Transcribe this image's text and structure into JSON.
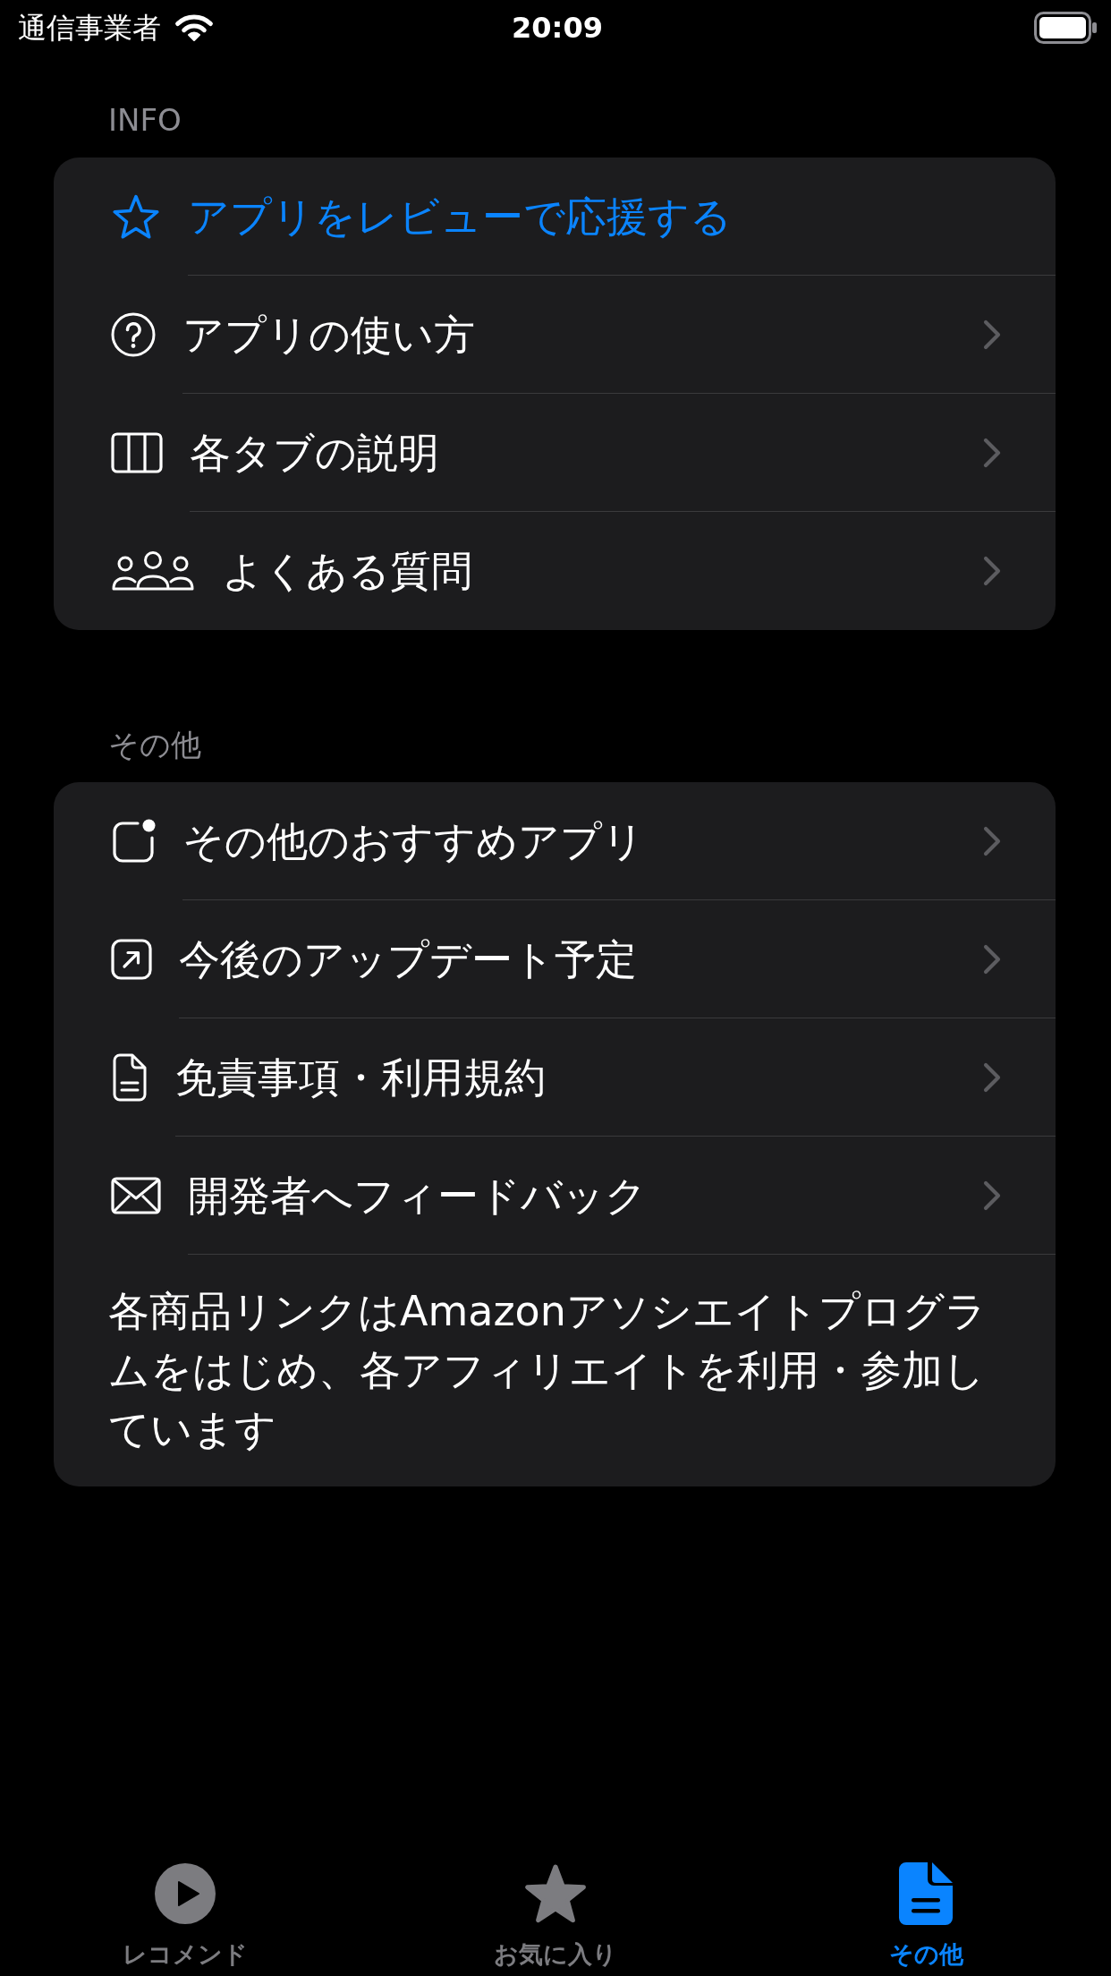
{
  "status_bar": {
    "carrier": "通信事業者",
    "time": "20:09"
  },
  "sections": [
    {
      "header": "INFO",
      "items": [
        {
          "label": "アプリをレビューで応援する",
          "kind": "action"
        },
        {
          "label": "アプリの使い方",
          "kind": "link"
        },
        {
          "label": "各タブの説明",
          "kind": "link"
        },
        {
          "label": "よくある質問",
          "kind": "link"
        }
      ]
    },
    {
      "header": "その他",
      "items": [
        {
          "label": "その他のおすすめアプリ",
          "kind": "link"
        },
        {
          "label": "今後のアップデート予定",
          "kind": "link"
        },
        {
          "label": "免責事項・利用規約",
          "kind": "link"
        },
        {
          "label": "開発者へフィードバック",
          "kind": "link"
        }
      ],
      "note": "各商品リンクはAmazonアソシエイトプログラムをはじめ、各アフィリエイトを利用・参加しています"
    }
  ],
  "tabs": [
    {
      "label": "レコメンド",
      "selected": false
    },
    {
      "label": "お気に入り",
      "selected": false
    },
    {
      "label": "その他",
      "selected": true
    }
  ]
}
